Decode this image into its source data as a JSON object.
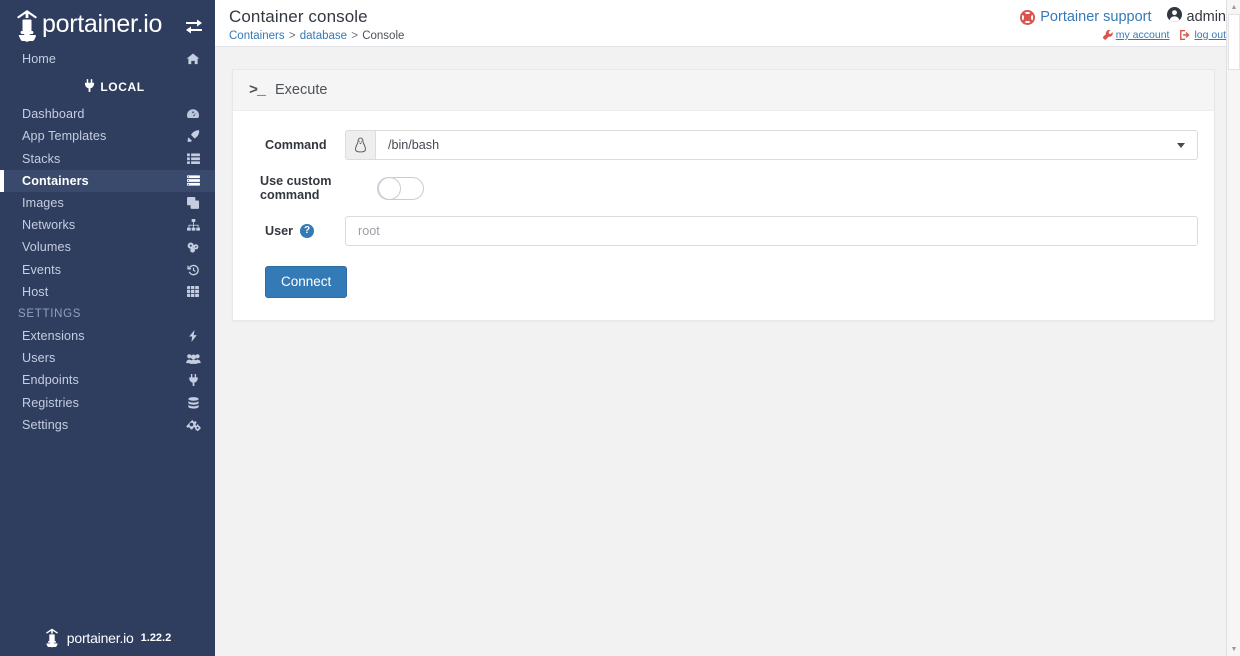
{
  "sidebar": {
    "brand": "portainer.io",
    "toggle_icon": "exchange-arrows-icon",
    "home": {
      "label": "Home",
      "icon": "home-icon"
    },
    "endpoint": {
      "label": "LOCAL",
      "icon": "plug-icon"
    },
    "items": [
      {
        "label": "Dashboard",
        "icon": "dashboard-icon",
        "active": false
      },
      {
        "label": "App Templates",
        "icon": "rocket-icon",
        "active": false
      },
      {
        "label": "Stacks",
        "icon": "list-icon",
        "active": false
      },
      {
        "label": "Containers",
        "icon": "server-stack-icon",
        "active": true
      },
      {
        "label": "Images",
        "icon": "clone-icon",
        "active": false
      },
      {
        "label": "Networks",
        "icon": "sitemap-icon",
        "active": false
      },
      {
        "label": "Volumes",
        "icon": "volumes-icon",
        "active": false
      },
      {
        "label": "Events",
        "icon": "history-icon",
        "active": false
      },
      {
        "label": "Host",
        "icon": "grid-icon",
        "active": false
      }
    ],
    "settings_title": "SETTINGS",
    "settings_items": [
      {
        "label": "Extensions",
        "icon": "bolt-icon"
      },
      {
        "label": "Users",
        "icon": "users-icon"
      },
      {
        "label": "Endpoints",
        "icon": "plug-icon"
      },
      {
        "label": "Registries",
        "icon": "database-icon"
      },
      {
        "label": "Settings",
        "icon": "cogs-icon"
      }
    ],
    "footer": {
      "brand": "portainer.io",
      "version": "1.22.2"
    }
  },
  "header": {
    "title": "Container console",
    "breadcrumb": {
      "items": [
        {
          "label": "Containers",
          "link": true
        },
        {
          "label": "database",
          "link": true
        },
        {
          "label": "Console",
          "link": false
        }
      ],
      "separator": ">"
    },
    "support_label": "Portainer support",
    "support_icon": "life-ring-icon",
    "user_name": "admin",
    "user_icon": "user-circle-icon",
    "my_account_label": "my account",
    "my_account_icon": "wrench-icon",
    "logout_label": "log out",
    "logout_icon": "sign-out-icon"
  },
  "panel": {
    "title": "Execute",
    "title_icon": "terminal-prompt-icon",
    "command": {
      "label": "Command",
      "addon_icon": "linux-tux-icon",
      "value": "/bin/bash",
      "caret_icon": "caret-down-icon"
    },
    "custom_command": {
      "label": "Use custom command",
      "state": "off"
    },
    "user": {
      "label": "User",
      "help_icon": "question-circle-icon",
      "help_glyph": "?",
      "placeholder": "root",
      "value": ""
    },
    "connect_button": "Connect"
  },
  "colors": {
    "sidebar_bg": "#2f3e5f",
    "accent_blue": "#337ab7",
    "support_red": "#d9534f",
    "content_bg": "#f2f2f2"
  }
}
